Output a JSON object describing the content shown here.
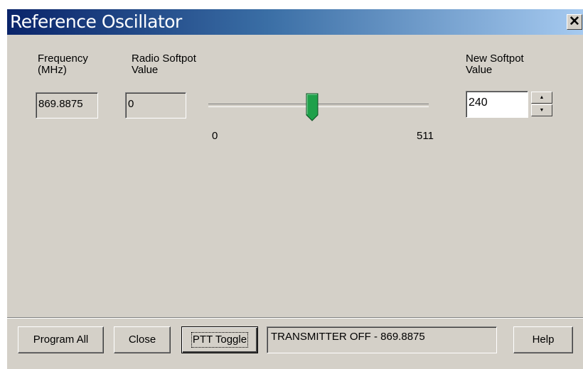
{
  "window": {
    "title": "Reference Oscillator",
    "close_glyph": "✕"
  },
  "frequency": {
    "label_line1": "Frequency",
    "label_line2": "(MHz)",
    "value": "869.8875"
  },
  "radio_softpot": {
    "label_line1": "Radio Softpot",
    "label_line2": "Value",
    "value": "0"
  },
  "slider": {
    "min_label": "0",
    "max_label": "511",
    "min": 0,
    "max": 511,
    "value": 240,
    "thumb_color": "#1fa04a"
  },
  "new_softpot": {
    "label_line1": "New Softpot",
    "label_line2": "Value",
    "value": "240",
    "spin_up": "▲",
    "spin_down": "▼"
  },
  "buttons": {
    "program_all": "Program All",
    "close": "Close",
    "ptt_toggle": "PTT Toggle",
    "help": "Help"
  },
  "status": {
    "text": "TRANSMITTER OFF - 869.8875"
  }
}
